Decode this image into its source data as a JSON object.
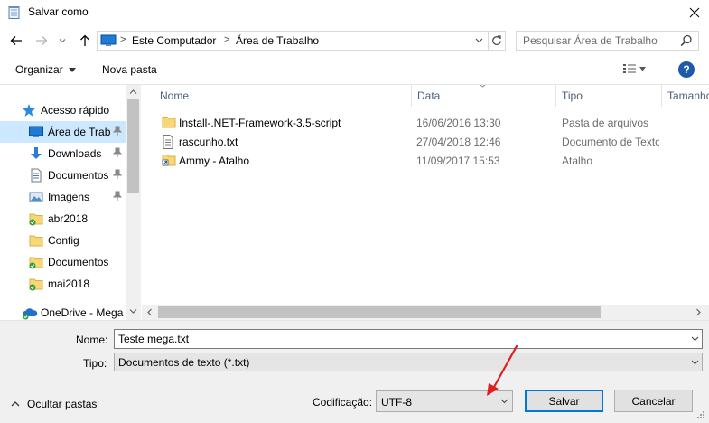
{
  "window": {
    "title": "Salvar como"
  },
  "address": {
    "crumbs": [
      "Este Computador",
      "Área de Trabalho"
    ],
    "separator": ">"
  },
  "search": {
    "placeholder": "Pesquisar Área de Trabalho"
  },
  "toolbar": {
    "organize_label": "Organizar",
    "new_folder_label": "Nova pasta",
    "help_label": "?"
  },
  "nav_pane": {
    "items": [
      {
        "label": "Acesso rápido",
        "icon": "star-icon",
        "pinned": false
      },
      {
        "label": "Área de Trabalho",
        "icon": "desktop-icon",
        "pinned": true,
        "selected": true
      },
      {
        "label": "Downloads",
        "icon": "download-icon",
        "pinned": true
      },
      {
        "label": "Documentos",
        "icon": "document-icon",
        "pinned": true
      },
      {
        "label": "Imagens",
        "icon": "image-icon",
        "pinned": true
      },
      {
        "label": "abr2018",
        "icon": "synced-folder-icon",
        "pinned": false
      },
      {
        "label": "Config",
        "icon": "folder-icon",
        "pinned": false
      },
      {
        "label": "Documentos",
        "icon": "synced-folder-icon",
        "pinned": false
      },
      {
        "label": "mai2018",
        "icon": "synced-folder-icon",
        "pinned": false
      },
      {
        "label": "OneDrive - Mega",
        "icon": "onedrive-icon",
        "pinned": false
      }
    ]
  },
  "file_list": {
    "columns": [
      "Nome",
      "Data",
      "Tipo",
      "Tamanho"
    ],
    "rows": [
      {
        "name": "Install-.NET-Framework-3.5-script",
        "date": "16/06/2016 13:30",
        "type": "Pasta de arquivos",
        "icon": "folder-icon"
      },
      {
        "name": "rascunho.txt",
        "date": "27/04/2018 12:46",
        "type": "Documento de Texto",
        "icon": "text-file-icon"
      },
      {
        "name": "Ammy - Atalho",
        "date": "11/09/2017 15:53",
        "type": "Atalho",
        "icon": "shortcut-icon"
      }
    ]
  },
  "form": {
    "name_label": "Nome:",
    "name_value": "Teste mega.txt",
    "type_label": "Tipo:",
    "type_value": "Documentos de texto (*.txt)",
    "encoding_label": "Codificação:",
    "encoding_value": "UTF-8",
    "hide_folders_label": "Ocultar pastas",
    "save_label": "Salvar",
    "cancel_label": "Cancelar"
  },
  "colors": {
    "accent": "#0078d7",
    "selection": "#cce8ff",
    "folder": "#f8d775",
    "annotation_arrow": "#e02020"
  }
}
